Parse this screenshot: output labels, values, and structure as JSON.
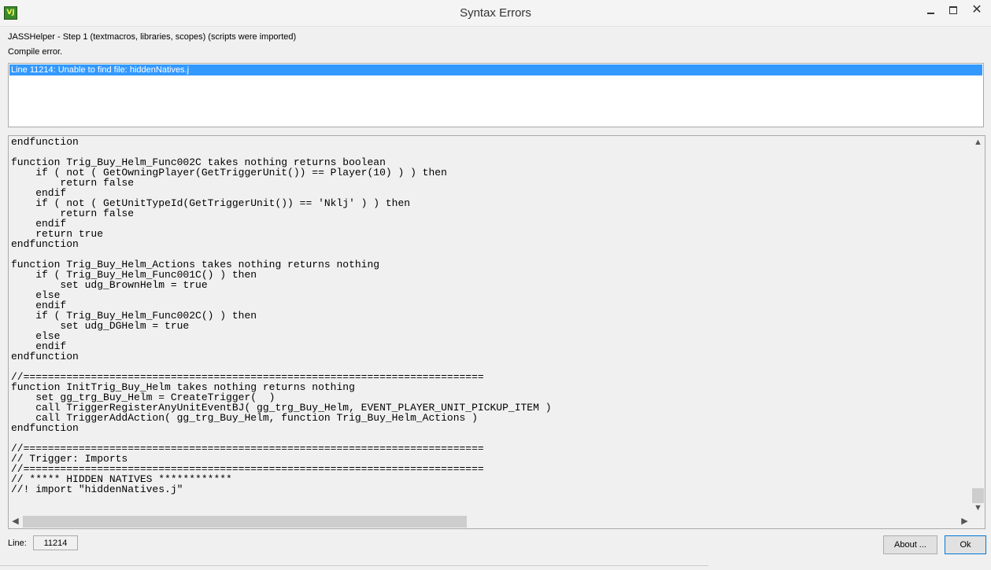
{
  "window": {
    "title": "Syntax Errors",
    "icon_text": "VJ",
    "controls": {
      "minimize": "minimize",
      "maximize": "maximize",
      "close": "✕"
    }
  },
  "header": {
    "step_text": "JASSHelper - Step 1 (textmacros, libraries, scopes) (scripts were imported)",
    "status_text": "Compile error."
  },
  "errors": [
    {
      "text": "Line 11214: Unable to find file: hiddenNatives.j",
      "selected": true
    }
  ],
  "code": {
    "lines": [
      "endfunction",
      "",
      "function Trig_Buy_Helm_Func002C takes nothing returns boolean",
      "    if ( not ( GetOwningPlayer(GetTriggerUnit()) == Player(10) ) ) then",
      "        return false",
      "    endif",
      "    if ( not ( GetUnitTypeId(GetTriggerUnit()) == 'Nklj' ) ) then",
      "        return false",
      "    endif",
      "    return true",
      "endfunction",
      "",
      "function Trig_Buy_Helm_Actions takes nothing returns nothing",
      "    if ( Trig_Buy_Helm_Func001C() ) then",
      "        set udg_BrownHelm = true",
      "    else",
      "    endif",
      "    if ( Trig_Buy_Helm_Func002C() ) then",
      "        set udg_DGHelm = true",
      "    else",
      "    endif",
      "endfunction",
      "",
      "//===========================================================================",
      "function InitTrig_Buy_Helm takes nothing returns nothing",
      "    set gg_trg_Buy_Helm = CreateTrigger(  )",
      "    call TriggerRegisterAnyUnitEventBJ( gg_trg_Buy_Helm, EVENT_PLAYER_UNIT_PICKUP_ITEM )",
      "    call TriggerAddAction( gg_trg_Buy_Helm, function Trig_Buy_Helm_Actions )",
      "endfunction",
      "",
      "//===========================================================================",
      "// Trigger: Imports",
      "//===========================================================================",
      "// ***** HIDDEN NATIVES ************",
      "//! import \"hiddenNatives.j\""
    ]
  },
  "footer": {
    "line_label": "Line:",
    "line_value": "11214",
    "about_label": "About ...",
    "ok_label": "Ok"
  },
  "colors": {
    "selection": "#3399ff",
    "window_bg": "#f0f0f0"
  }
}
